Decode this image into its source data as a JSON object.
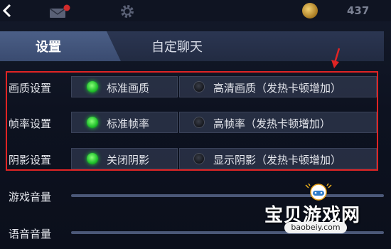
{
  "topbar": {
    "coin_value": "437",
    "colors": {
      "coin": "#d3a43a",
      "coin_value": "#7b8193",
      "mail_badge": "#d12b2b"
    }
  },
  "tabs": [
    {
      "label": "设置",
      "active": true
    },
    {
      "label": "自定聊天",
      "active": false
    }
  ],
  "settings": {
    "rows": [
      {
        "label": "画质设置",
        "options": [
          {
            "label": "标准画质",
            "selected": true
          },
          {
            "label": "高清画质（发热卡顿增加）",
            "selected": false
          }
        ]
      },
      {
        "label": "帧率设置",
        "options": [
          {
            "label": "标准帧率",
            "selected": true
          },
          {
            "label": "高帧率（发热卡顿增加）",
            "selected": false
          }
        ]
      },
      {
        "label": "阴影设置",
        "options": [
          {
            "label": "关闭阴影",
            "selected": true
          },
          {
            "label": "显示阴影（发热卡顿增加）",
            "selected": false
          }
        ]
      }
    ],
    "volumes": [
      {
        "label": "游戏音量"
      },
      {
        "label": "语音音量"
      }
    ]
  },
  "annotation": {
    "highlight_color": "#e02424"
  },
  "watermark": {
    "text": "宝贝游戏网",
    "url": "baobeiy.com"
  }
}
